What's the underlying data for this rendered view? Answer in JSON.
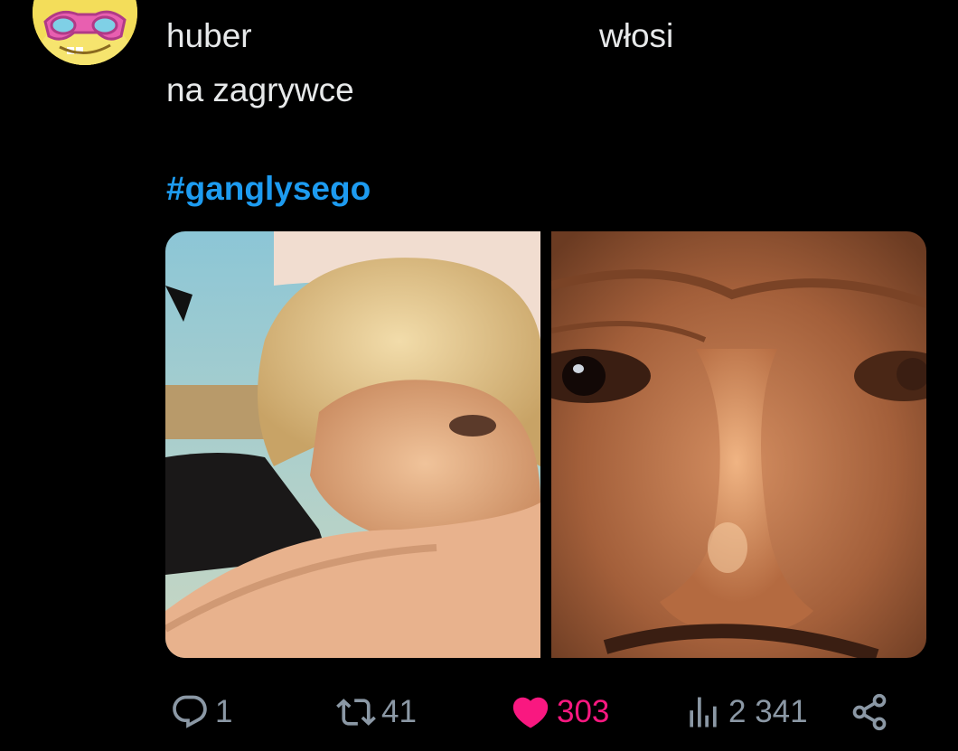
{
  "tweet": {
    "line1_left": "huber",
    "line1_right": "włosi",
    "line2": "na zagrywce",
    "hashtag": "#ganglysego"
  },
  "media": [
    {
      "icon": "blonde-person-photo"
    },
    {
      "icon": "face-closeup-photo"
    }
  ],
  "actions": {
    "reply": {
      "icon": "reply-icon",
      "count": "1"
    },
    "retweet": {
      "icon": "retweet-icon",
      "count": "41"
    },
    "like": {
      "icon": "heart-icon",
      "count": "303",
      "liked": true,
      "color": "#f91880"
    },
    "views": {
      "icon": "views-icon",
      "count": "2 341"
    },
    "share": {
      "icon": "share-icon"
    }
  },
  "colors": {
    "background": "#000000",
    "text": "#e7e9ea",
    "hashtag": "#1d9bf0",
    "muted": "#8b98a5",
    "like": "#f91880"
  }
}
